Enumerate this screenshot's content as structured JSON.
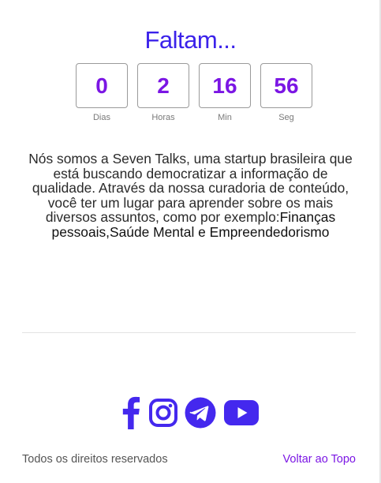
{
  "countdown": {
    "title": "Faltam...",
    "units": [
      {
        "value": "0",
        "label": "Dias"
      },
      {
        "value": "2",
        "label": "Horas"
      },
      {
        "value": "16",
        "label": "Min"
      },
      {
        "value": "56",
        "label": "Seg"
      }
    ]
  },
  "description": {
    "text": "Nós somos a Seven Talks, uma startup brasileira que está buscando democratizar a informação de qualidade. Através da nossa curadoria de conteúdo, você ter um lugar para aprender sobre os mais diversos assuntos, como por exemplo:",
    "topics": "Finanças pessoais,Saúde Mental e Empreendedorismo"
  },
  "social": {
    "icons": [
      "facebook-icon",
      "instagram-icon",
      "telegram-icon",
      "youtube-icon"
    ],
    "color": "#4428ee"
  },
  "footer": {
    "rights": "Todos os direitos reservados",
    "back_to_top": "Voltar ao Topo"
  },
  "colors": {
    "title": "#3b22ea",
    "accent": "#7b16e4"
  }
}
